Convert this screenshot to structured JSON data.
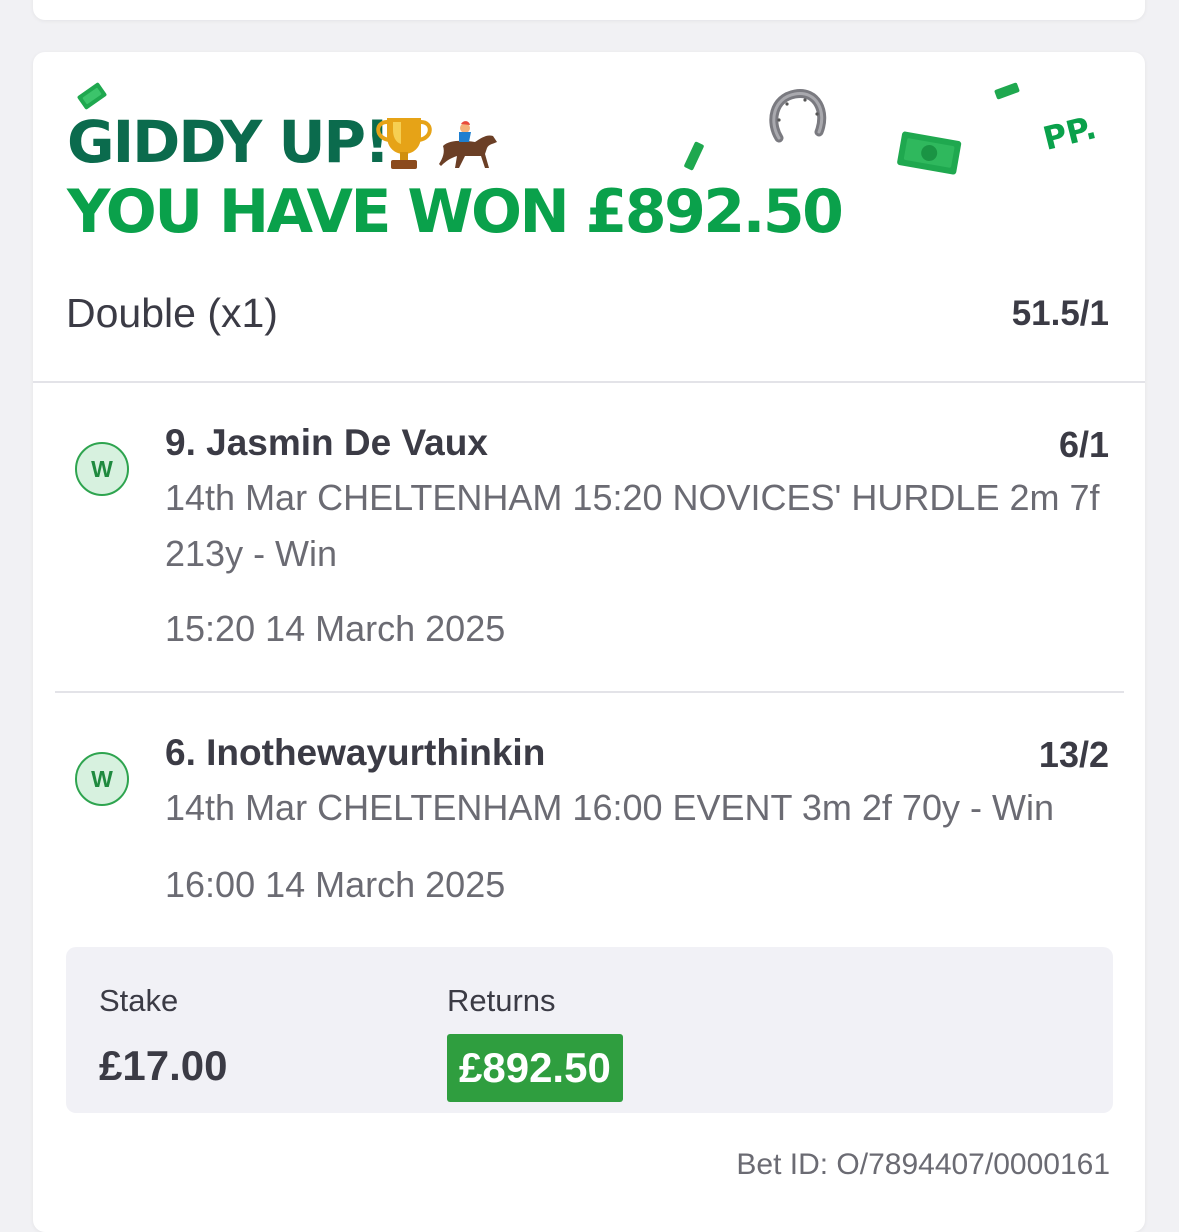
{
  "banner": {
    "line1": "GIDDY UP!",
    "line2": "YOU HAVE WON £892.50",
    "badge_text": "PP."
  },
  "bet": {
    "type": "Double (x1)",
    "odds": "51.5/1"
  },
  "selections": [
    {
      "status": "W",
      "name": "9. Jasmin De Vaux",
      "odds": "6/1",
      "description": "14th Mar CHELTENHAM 15:20 NOVICES' HURDLE 2m 7f 213y - Win",
      "time": "15:20 14 March 2025"
    },
    {
      "status": "W",
      "name": "6. Inothewayurthinkin",
      "odds": "13/2",
      "description": "14th Mar CHELTENHAM 16:00 EVENT 3m 2f 70y - Win",
      "time": "16:00 14 March 2025"
    }
  ],
  "summary": {
    "stake_label": "Stake",
    "stake_value": "£17.00",
    "returns_label": "Returns",
    "returns_value": "£892.50"
  },
  "bet_id": "Bet ID: O/7894407/0000161",
  "colors": {
    "dark_green": "#0b6b4d",
    "bright_green": "#0aa14b",
    "returns_green": "#2f9e3f",
    "text": "#3b3b45",
    "muted_text": "#6b6b73"
  },
  "icons": [
    "trophy-icon",
    "jockey-icon",
    "horseshoe-icon",
    "money-icon"
  ]
}
